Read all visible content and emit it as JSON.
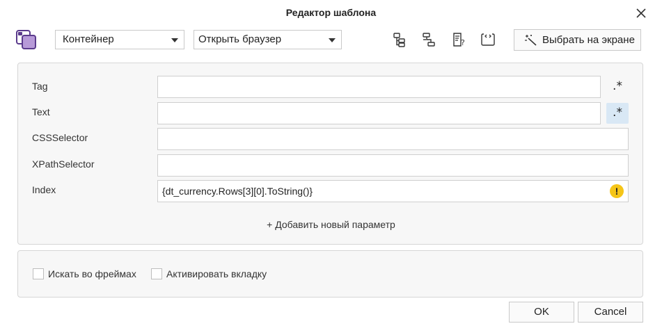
{
  "dialog": {
    "title": "Редактор шаблона"
  },
  "toolbar": {
    "type_select": "Контейнер",
    "action_select": "Открыть браузер",
    "pick_button": "Выбрать на экране"
  },
  "params": {
    "rows": [
      {
        "label": "Tag",
        "value": "",
        "regex": ".*"
      },
      {
        "label": "Text",
        "value": "",
        "regex": ".*"
      },
      {
        "label": "CSSSelector",
        "value": ""
      },
      {
        "label": "XPathSelector",
        "value": ""
      },
      {
        "label": "Index",
        "value": "{dt_currency.Rows[3][0].ToString()}",
        "warning": "!"
      }
    ],
    "add_label": "+ Добавить новый параметр"
  },
  "options": {
    "search_frames": "Искать во фреймах",
    "activate_tab": "Активировать вкладку"
  },
  "footer": {
    "ok": "OK",
    "cancel": "Cancel"
  },
  "colors": {
    "accent": "#6a3fa0",
    "regex_active_bg": "#d9e8f5",
    "warning": "#f5c518"
  }
}
